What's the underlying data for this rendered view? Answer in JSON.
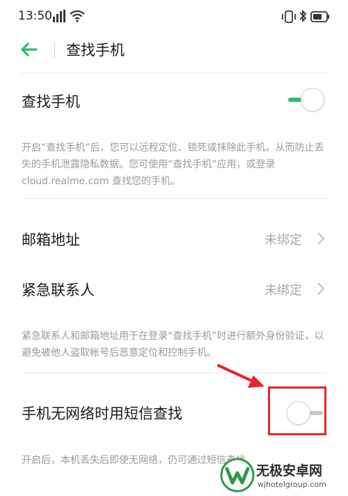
{
  "status_bar": {
    "time": "13:50",
    "icons": [
      "signal-icon",
      "wifi-icon",
      "vibrate-icon",
      "bluetooth-icon",
      "battery-icon"
    ]
  },
  "header": {
    "title": "查找手机",
    "back_icon": "arrow-left-icon"
  },
  "settings": {
    "find_phone": {
      "label": "查找手机",
      "enabled": true,
      "description": "开启“查找手机”后，您可以远程定位、锁死或抹除此手机。从而防止丢失的手机泄露隐私数据。您可使用“查找手机”应用，或登录 cloud.realme.com 查找您的手机。"
    },
    "email": {
      "label": "邮箱地址",
      "value": "未绑定"
    },
    "emergency_contact": {
      "label": "紧急联系人",
      "value": "未绑定"
    },
    "verification_description": "紧急联系人和邮箱地址用于在登录“查找手机”时进行额外身份验证，以避免被他人盗取帐号后恶意定位和控制手机。",
    "sms_find": {
      "label": "手机无网络时用短信查找",
      "enabled": false,
      "description": "开启后，本机丢失后即使无网络，仍可通过短信查找"
    }
  },
  "watermark": {
    "title": "无极安卓网",
    "url": "wjhotelgroup.com"
  },
  "colors": {
    "accent_green": "#2ebd6a",
    "highlight_red": "#e8242e"
  }
}
